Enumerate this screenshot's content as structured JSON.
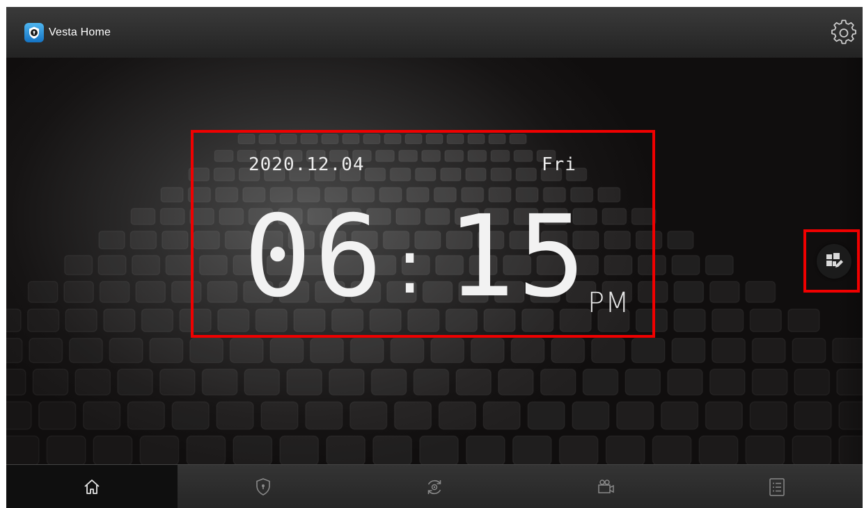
{
  "app": {
    "name": "Vesta Home"
  },
  "clock": {
    "date": "2020.12.04",
    "weekday": "Fri",
    "hour": "06",
    "separator": ":",
    "minute": "15",
    "ampm": "PM"
  },
  "nav": {
    "items": [
      {
        "icon": "home-icon",
        "active": true
      },
      {
        "icon": "shield-icon",
        "active": false
      },
      {
        "icon": "automation-icon",
        "active": false
      },
      {
        "icon": "camera-icon",
        "active": false
      },
      {
        "icon": "list-icon",
        "active": false
      }
    ]
  },
  "icons": {
    "settings": "gear-icon",
    "widget_edit": "widget-edit-icon",
    "logo": "shield-logo-icon"
  },
  "colors": {
    "highlight": "#f00000",
    "brand": "#1e88d8",
    "text": "#eeeeee",
    "nav_icon": "#8a8a8a"
  }
}
